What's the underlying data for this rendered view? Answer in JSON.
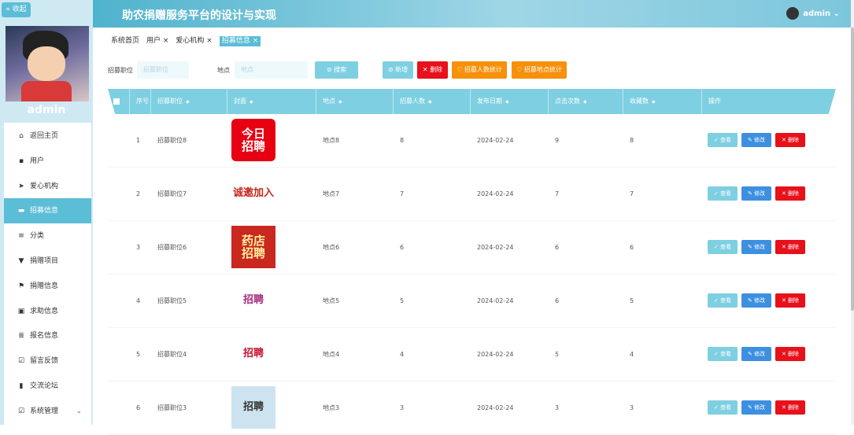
{
  "sidebar": {
    "collapse_label": "« 收起",
    "username": "admin",
    "menu": [
      {
        "label": "返回主页",
        "icon": "home-icon",
        "glyph": "⌂"
      },
      {
        "label": "用户",
        "icon": "grid-icon",
        "glyph": "▪"
      },
      {
        "label": "爱心机构",
        "icon": "send-icon",
        "glyph": "➤"
      },
      {
        "label": "招募信息",
        "icon": "card-icon",
        "glyph": "▬"
      },
      {
        "label": "分类",
        "icon": "sliders-icon",
        "glyph": "≡"
      },
      {
        "label": "捐赠项目",
        "icon": "trophy-icon",
        "glyph": "▼"
      },
      {
        "label": "捐赠信息",
        "icon": "flag-icon",
        "glyph": "⚑"
      },
      {
        "label": "求助信息",
        "icon": "clipboard-icon",
        "glyph": "▣"
      },
      {
        "label": "报名信息",
        "icon": "list-icon",
        "glyph": "≣"
      },
      {
        "label": "留言反馈",
        "icon": "check-square-icon",
        "glyph": "☑"
      },
      {
        "label": "交流论坛",
        "icon": "bar-chart-icon",
        "glyph": "▮"
      },
      {
        "label": "系统管理",
        "icon": "check-box-icon",
        "glyph": "☑"
      }
    ],
    "active_index": 3
  },
  "header": {
    "title": "助农捐赠服务平台的设计与实现",
    "user": "admin ⌄"
  },
  "tabs": [
    {
      "label": "系统首页",
      "closable": false
    },
    {
      "label": "用户 ×",
      "closable": true
    },
    {
      "label": "爱心机构 ×",
      "closable": true
    },
    {
      "label": "招募信息 ×",
      "closable": true,
      "active": true
    }
  ],
  "search": {
    "position_label": "招募职位",
    "position_placeholder": "招募职位",
    "location_label": "地点",
    "location_placeholder": "地点",
    "search_btn": "⊘ 搜索",
    "add_btn": "⊘ 新增",
    "delete_btn": "✕ 删除",
    "stat_people_btn": "♡ 招募人数统计",
    "stat_location_btn": "♡ 招募地点统计"
  },
  "table": {
    "headers": [
      "序号",
      "招募职位",
      "封面",
      "地点",
      "招募人数",
      "发布日期",
      "点击次数",
      "收藏数",
      "操作"
    ],
    "actions": {
      "view": "✓ 查看",
      "edit": "✎ 修改",
      "delete": "✕ 删除"
    },
    "rows": [
      {
        "no": "1",
        "position": "招募职位8",
        "location": "地点8",
        "count": "8",
        "date": "2024-02-24",
        "clicks": "9",
        "favorites": "8",
        "cover_text": "今日\n招聘"
      },
      {
        "no": "2",
        "position": "招募职位7",
        "location": "地点7",
        "count": "7",
        "date": "2024-02-24",
        "clicks": "7",
        "favorites": "7",
        "cover_text": "诚邀加入"
      },
      {
        "no": "3",
        "position": "招募职位6",
        "location": "地点6",
        "count": "6",
        "date": "2024-02-24",
        "clicks": "6",
        "favorites": "6",
        "cover_text": "药店\n招聘"
      },
      {
        "no": "4",
        "position": "招募职位5",
        "location": "地点5",
        "count": "5",
        "date": "2024-02-24",
        "clicks": "6",
        "favorites": "5",
        "cover_text": "招聘"
      },
      {
        "no": "5",
        "position": "招募职位4",
        "location": "地点4",
        "count": "4",
        "date": "2024-02-24",
        "clicks": "5",
        "favorites": "4",
        "cover_text": "招聘"
      },
      {
        "no": "6",
        "position": "招募职位3",
        "location": "地点3",
        "count": "3",
        "date": "2024-02-24",
        "clicks": "3",
        "favorites": "3",
        "cover_text": "招聘"
      }
    ]
  },
  "colors": {
    "accent": "#5bbdd6",
    "header": "#7ecfe1",
    "edit": "#3d8fe0",
    "delete": "#e8101a",
    "stat": "#f7900a"
  }
}
